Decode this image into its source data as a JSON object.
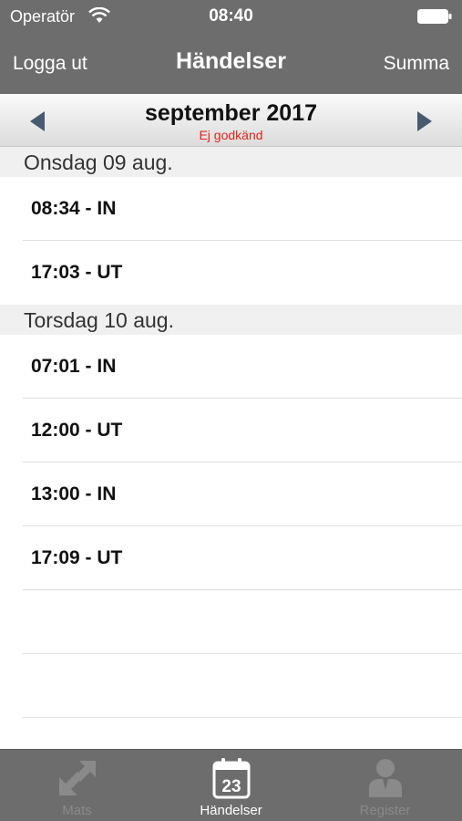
{
  "status_bar": {
    "carrier": "Operatör",
    "time": "08:40",
    "wifi_icon": "wifi-icon",
    "battery_icon": "battery-icon"
  },
  "nav": {
    "left_button": "Logga ut",
    "title": "Händelser",
    "right_button": "Summa"
  },
  "month_selector": {
    "month": "september 2017",
    "status": "Ej godkänd",
    "status_color": "#e0231b",
    "prev_icon": "left-arrow-icon",
    "next_icon": "right-arrow-icon"
  },
  "sections": [
    {
      "header": "Onsdag 09 aug.",
      "events": [
        "08:34 - IN",
        "17:03 - UT"
      ]
    },
    {
      "header": "Torsdag 10 aug.",
      "events": [
        "07:01 - IN",
        "12:00 - UT",
        "13:00 - IN",
        "17:09 - UT"
      ]
    }
  ],
  "tabbar": {
    "tabs": [
      {
        "label": "Mats",
        "icon": "arrows-swap-icon",
        "active": false
      },
      {
        "label": "Händelser",
        "icon": "calendar-icon",
        "active": true,
        "icon_text": "23"
      },
      {
        "label": "Register",
        "icon": "person-icon",
        "active": false
      }
    ]
  },
  "colors": {
    "bar_background": "#6d6d6d",
    "section_header_bg": "#f0f0f0"
  }
}
